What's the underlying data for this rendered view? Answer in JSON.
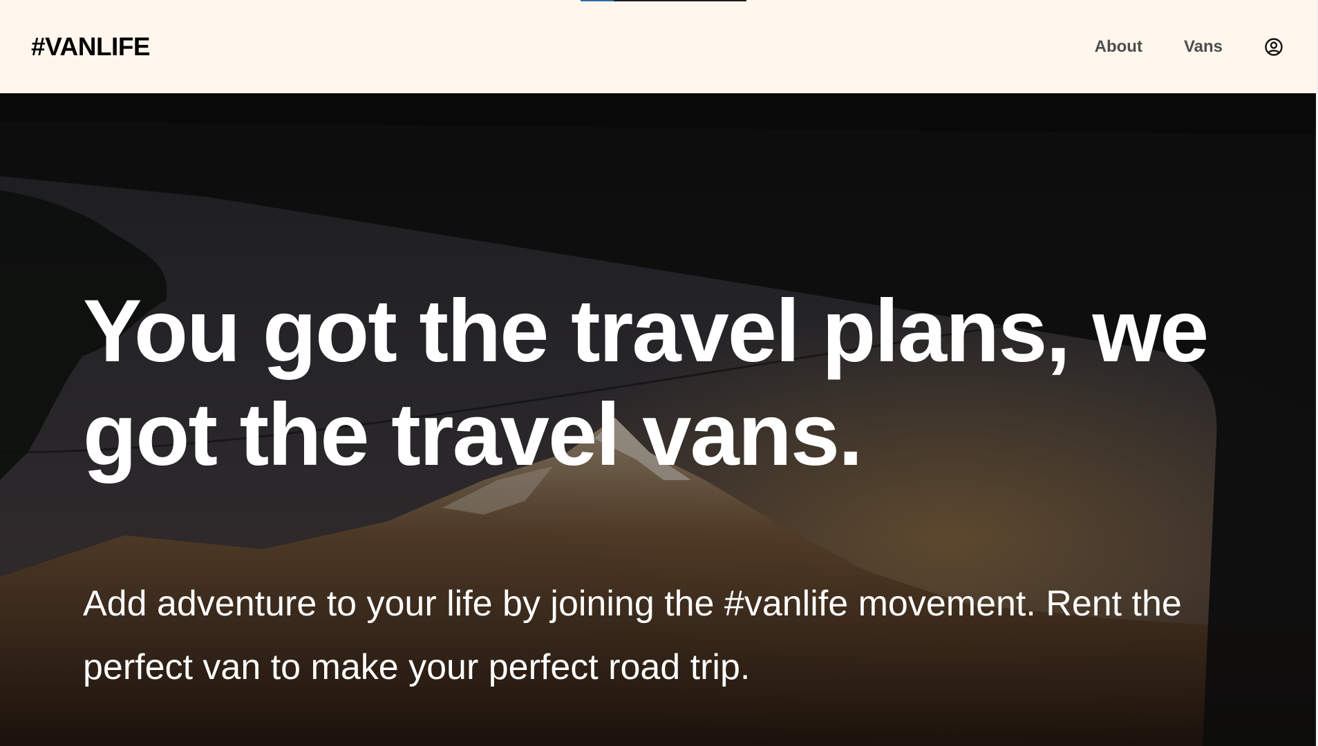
{
  "header": {
    "logo": "#VANLIFE",
    "nav": {
      "about": "About",
      "vans": "Vans",
      "login_icon": "user-circle-icon"
    }
  },
  "hero": {
    "headline": "You got the travel plans, we got the travel vans.",
    "subline": "Add adventure to your life by joining the #vanlife movement. Rent the perfect van to make your perfect road trip."
  },
  "loading_bar": {
    "progress": 0.2
  },
  "colors": {
    "header_bg": "#fff7ed",
    "logo_text": "#000000",
    "nav_text": "#4d4d4d",
    "hero_text": "#ffffff",
    "progress_fill": "#2d6da8"
  }
}
